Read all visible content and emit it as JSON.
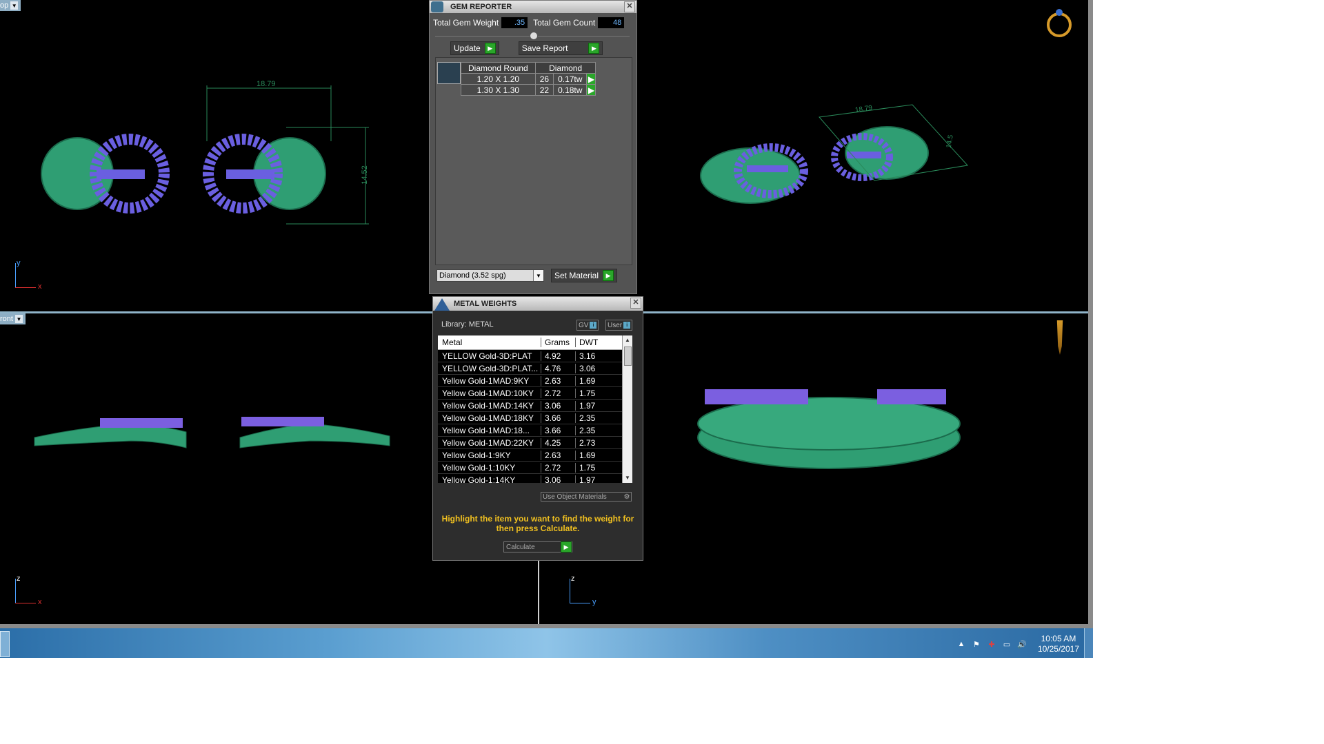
{
  "viewports": {
    "top_label": "op",
    "front_label": "ront",
    "top_left_axes": {
      "h": "x",
      "v": "y"
    },
    "bottom_left_axes": {
      "h": "x",
      "v": "z"
    },
    "bottom_right_axes": {
      "h": "y",
      "v": "z"
    },
    "dim_width": "18.79",
    "dim_height": "14.52",
    "persp_dim_width": "18.79",
    "persp_dim_height": "14.5"
  },
  "gem_reporter": {
    "title": "GEM REPORTER",
    "total_weight_label": "Total Gem Weight",
    "total_weight_value": ".35",
    "total_count_label": "Total Gem Count",
    "total_count_value": "48",
    "update_label": "Update",
    "save_label": "Save Report",
    "columns": [
      "Diamond Round",
      "Diamond"
    ],
    "rows": [
      {
        "size": "1.20 X 1.20",
        "count": "26",
        "weight": "0.17tw"
      },
      {
        "size": "1.30 X 1.30",
        "count": "22",
        "weight": "0.18tw"
      }
    ],
    "material_select": "Diamond    (3.52 spg)",
    "set_material_label": "Set Material"
  },
  "metal_weights": {
    "title": "METAL WEIGHTS",
    "library": "Library: METAL",
    "toggle_gv": "GV",
    "toggle_user": "User",
    "columns": [
      "Metal",
      "Grams",
      "DWT"
    ],
    "rows": [
      {
        "metal": "YELLOW Gold-3D:PLAT",
        "grams": "4.92",
        "dwt": "3.16"
      },
      {
        "metal": "YELLOW Gold-3D:PLAT...",
        "grams": "4.76",
        "dwt": "3.06"
      },
      {
        "metal": "Yellow Gold-1MAD:9KY",
        "grams": "2.63",
        "dwt": "1.69"
      },
      {
        "metal": "Yellow Gold-1MAD:10KY",
        "grams": "2.72",
        "dwt": "1.75"
      },
      {
        "metal": "Yellow Gold-1MAD:14KY",
        "grams": "3.06",
        "dwt": "1.97"
      },
      {
        "metal": "Yellow Gold-1MAD:18KY",
        "grams": "3.66",
        "dwt": "2.35"
      },
      {
        "metal": "Yellow Gold-1MAD:18...",
        "grams": "3.66",
        "dwt": "2.35"
      },
      {
        "metal": "Yellow Gold-1MAD:22KY",
        "grams": "4.25",
        "dwt": "2.73"
      },
      {
        "metal": "Yellow Gold-1:9KY",
        "grams": "2.63",
        "dwt": "1.69"
      },
      {
        "metal": "Yellow Gold-1:10KY",
        "grams": "2.72",
        "dwt": "1.75"
      },
      {
        "metal": "Yellow Gold-1:14KY",
        "grams": "3.06",
        "dwt": "1.97"
      }
    ],
    "use_object_label": "Use Object Materials",
    "hint": "Highlight the item you want to find the weight for then press Calculate.",
    "calculate_label": "Calculate"
  },
  "taskbar": {
    "time": "10:05 AM",
    "date": "10/25/2017"
  },
  "colors": {
    "model_green": "#2f9e73",
    "gem_purple": "#6a5fe0",
    "accent_blue": "#8eaec4"
  }
}
